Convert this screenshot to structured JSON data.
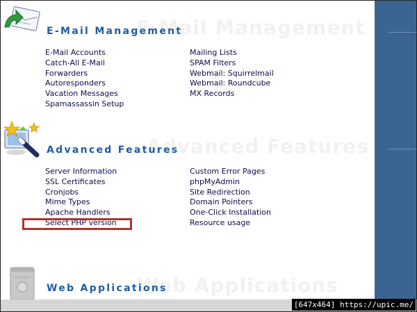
{
  "sections": {
    "email": {
      "title": "E-Mail Management",
      "left_links": [
        "E-Mail Accounts",
        "Catch-All E-Mail",
        "Forwarders",
        "Autoresponders",
        "Vacation Messages",
        "Spamassassin Setup"
      ],
      "right_links": [
        "Mailing Lists",
        "SPAM Filters",
        "Webmail: Squirrelmail",
        "Webmail: Roundcube",
        "MX Records"
      ]
    },
    "advanced": {
      "title": "Advanced Features",
      "left_links": [
        "Server Information",
        "SSL Certificates",
        "Cronjobs",
        "Mime Types",
        "Apache Handlers",
        "Select PHP version"
      ],
      "right_links": [
        "Custom Error Pages",
        "phpMyAdmin",
        "Site Redirection",
        "Domain Pointers",
        "One-Click Installation",
        "Resource usage"
      ]
    },
    "webapps": {
      "title": "Web Applications"
    }
  },
  "image_size_label": "[647x464] https://upic.me/",
  "colors": {
    "sidebar": "#3a6593",
    "heading": "#1f5ca8",
    "link": "#0c0c4a",
    "highlight_border": "#b03330"
  },
  "icons": {
    "email": "envelope-arrow-icon",
    "advanced": "magic-wand-stars-icon",
    "webapps": "server-tower-icon"
  }
}
